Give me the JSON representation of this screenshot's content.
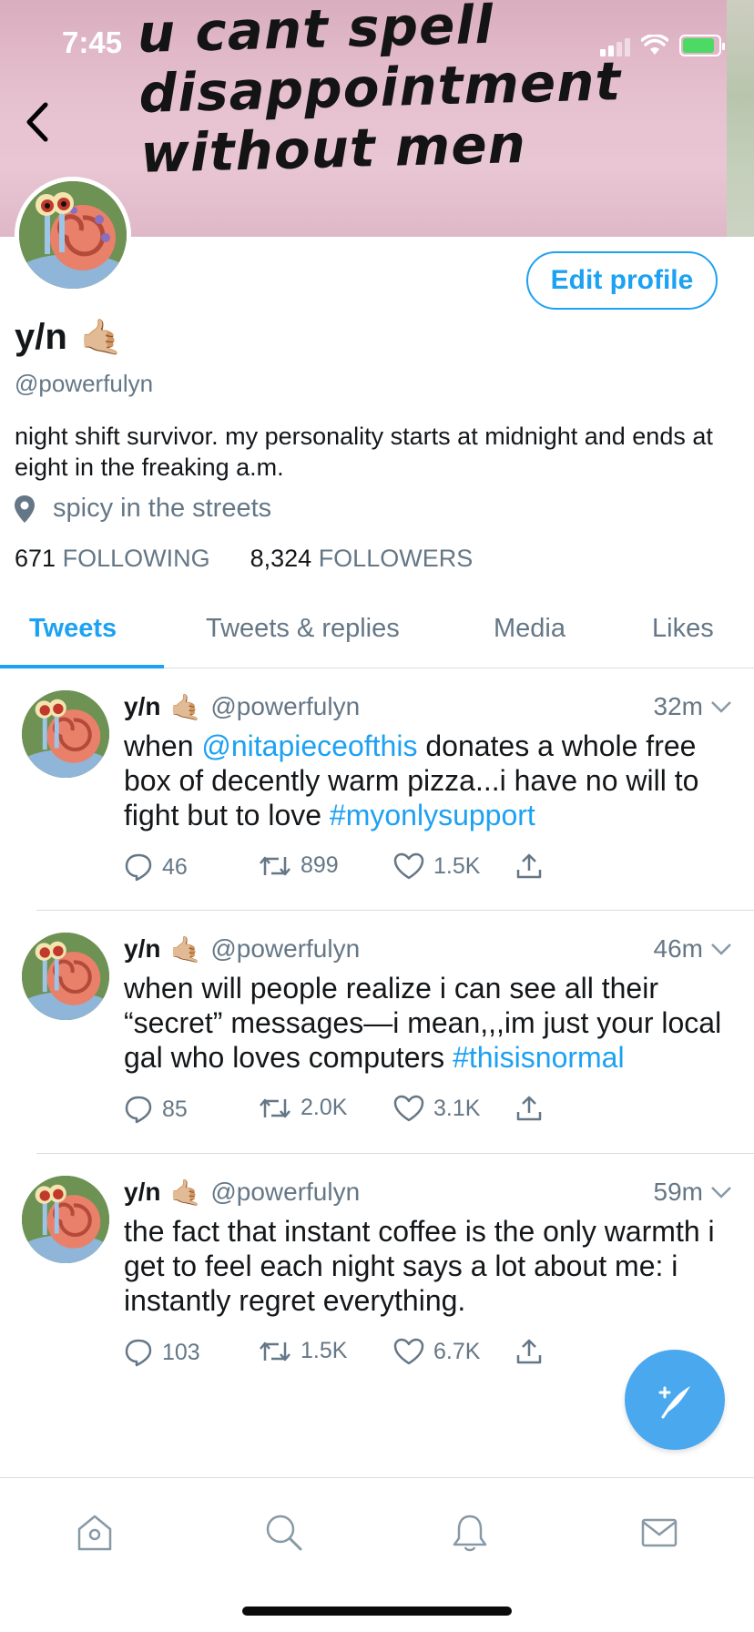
{
  "status_bar": {
    "time": "7:45"
  },
  "banner": {
    "lines": [
      "u cant spell",
      "disappointment",
      "without men"
    ]
  },
  "profile": {
    "name": "y/n",
    "name_emoji": "🤙🏼",
    "handle": "@powerfulyn",
    "edit_label": "Edit profile",
    "bio": "night shift survivor. my personality starts at midnight and ends at eight in the freaking a.m.",
    "location": "spicy in the streets",
    "following_count": "671",
    "following_label": "FOLLOWING",
    "followers_count": "8,324",
    "followers_label": "FOLLOWERS"
  },
  "tabs": [
    {
      "label": "Tweets",
      "active": true
    },
    {
      "label": "Tweets & replies"
    },
    {
      "label": "Media"
    },
    {
      "label": "Likes"
    }
  ],
  "tweets": [
    {
      "name": "y/n",
      "handle": "@powerfulyn",
      "time": "32m",
      "text_parts": [
        "when ",
        "@nitapieceofthis",
        " donates a whole free box of decently warm pizza...i have no will to fight but to love ",
        "#myonlysupport"
      ],
      "replies": "46",
      "retweets": "899",
      "likes": "1.5K"
    },
    {
      "name": "y/n",
      "handle": "@powerfulyn",
      "time": "46m",
      "text_parts": [
        "when will people realize i can see all their “secret” messages—i mean,,,im just your local gal who loves computers ",
        "#thisisnormal"
      ],
      "replies": "85",
      "retweets": "2.0K",
      "likes": "3.1K"
    },
    {
      "name": "y/n",
      "handle": "@powerfulyn",
      "time": "59m",
      "text_parts": [
        "the fact that instant coffee is the only warmth i get to feel each night says a lot about me: i instantly regret everything."
      ],
      "replies": "103",
      "retweets": "1.5K",
      "likes": "6.7K"
    }
  ],
  "icons": {
    "back": "chevron-left-icon",
    "location": "map-pin-icon",
    "reply": "reply-icon",
    "retweet": "retweet-icon",
    "like": "heart-icon",
    "share": "share-icon",
    "compose": "compose-tweet-icon",
    "nav": [
      "home-icon",
      "search-icon",
      "notifications-icon",
      "messages-icon"
    ]
  },
  "colors": {
    "accent": "#1da1f2",
    "muted": "#657786",
    "text": "#14171a"
  }
}
